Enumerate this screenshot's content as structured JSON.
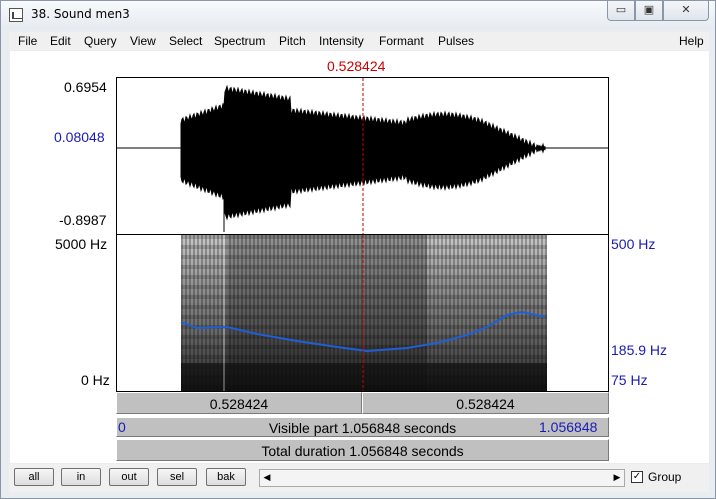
{
  "window": {
    "title": "38. Sound men3"
  },
  "title_buttons": {
    "minimize": "▭",
    "maximize": "▣",
    "close": "✕"
  },
  "menu": [
    "File",
    "Edit",
    "Query",
    "View",
    "Select",
    "Spectrum",
    "Pitch",
    "Intensity",
    "Formant",
    "Pulses",
    "Help"
  ],
  "cursor_time": "0.528424",
  "waveform": {
    "max": "0.6954",
    "cursor_value": "0.08048",
    "min": "-0.8987"
  },
  "spectrogram": {
    "max_freq": "5000 Hz",
    "min_freq": "0 Hz"
  },
  "pitch": {
    "max": "500 Hz",
    "cursor_value": "185.9 Hz",
    "min": "75 Hz"
  },
  "selection_row": {
    "left": "0.528424",
    "right": "0.528424"
  },
  "visible_row": {
    "start": "0",
    "label": "Visible part 1.056848 seconds",
    "end": "1.056848"
  },
  "total_row": {
    "label": "Total duration 1.056848 seconds"
  },
  "buttons": {
    "all": "all",
    "in": "in",
    "out": "out",
    "sel": "sel",
    "bak": "bak"
  },
  "scrollbar": {
    "left_arrow": "◀",
    "right_arrow": "▶"
  },
  "group": {
    "label": "Group",
    "checked": true,
    "mark": "✓"
  },
  "colors": {
    "cursor": "#cc0000",
    "pitch_curve": "#1f5fd6",
    "blue_label": "#1a1ab4"
  }
}
